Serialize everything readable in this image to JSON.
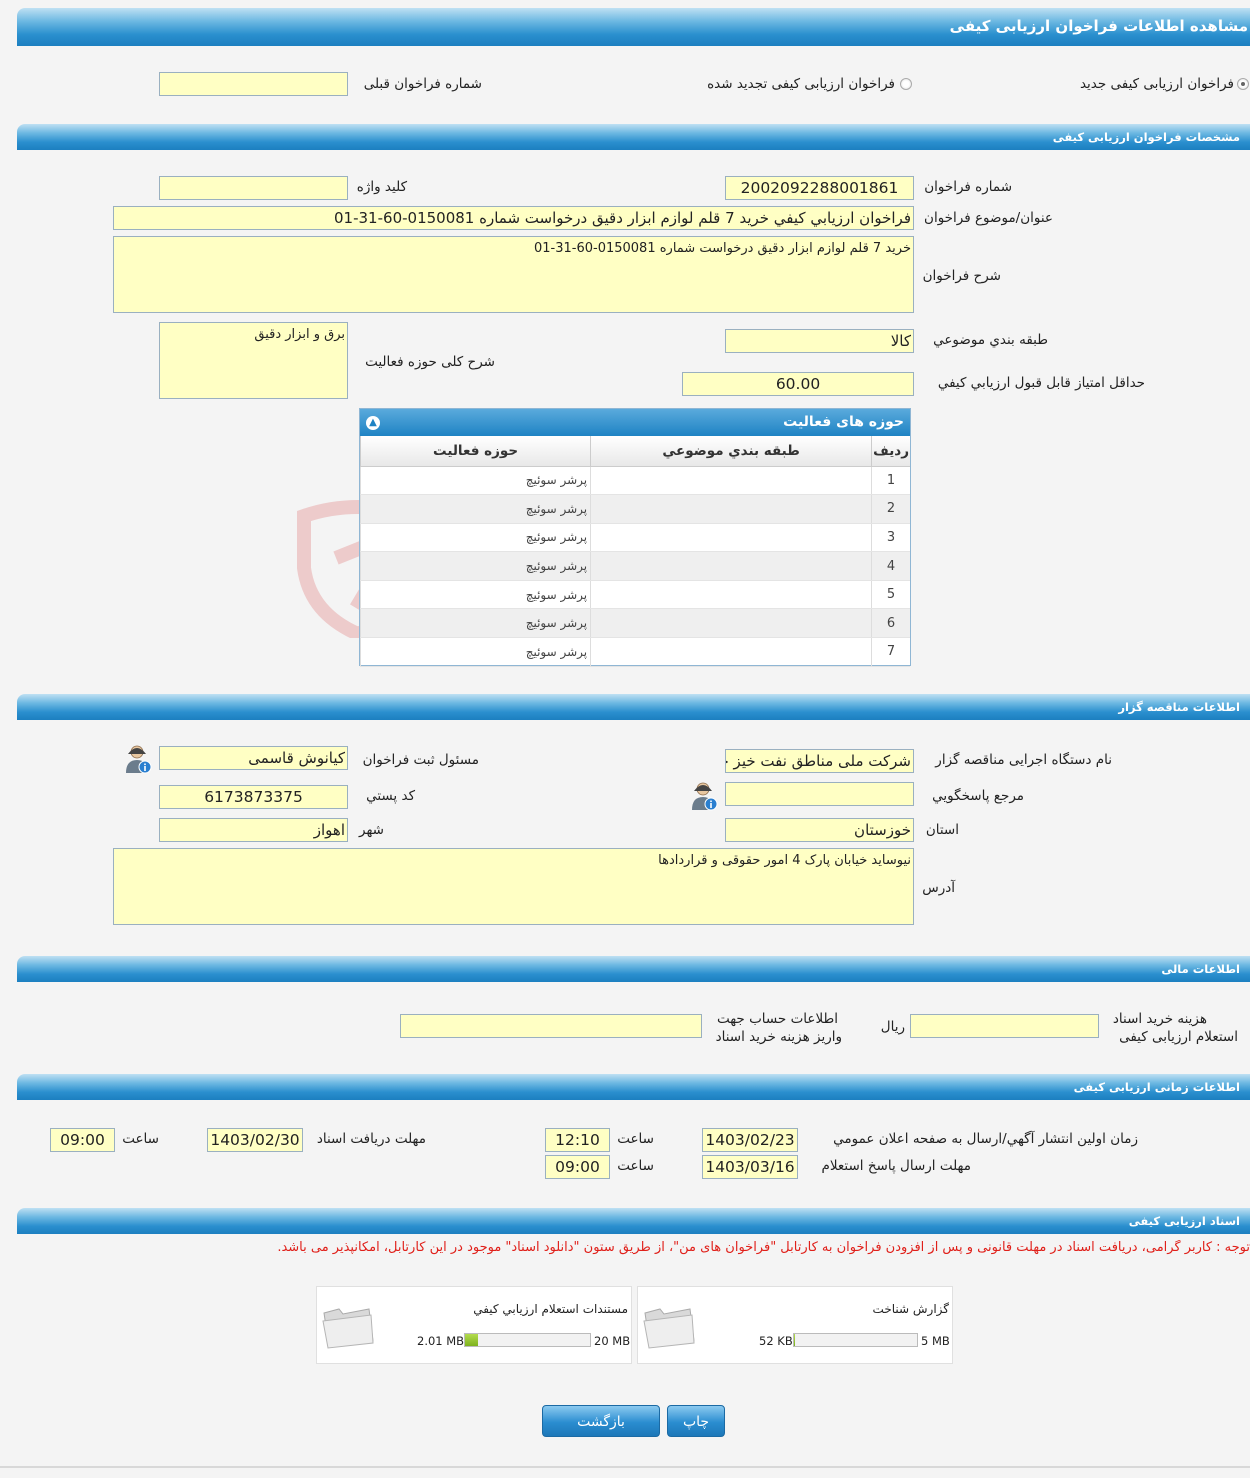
{
  "page_title": "مشاهده اطلاعات فراخوان ارزیابی کیفی",
  "type_options": {
    "new_label": "فراخوان ارزیابی کیفی جدید",
    "renewed_label": "فراخوان ارزیابی کیفی تجدید شده",
    "prev_number_label": "شماره فراخوان قبلی",
    "prev_number_value": "",
    "selected": "new"
  },
  "spec": {
    "section_title": "مشخصات فراخوان ارزیابی کیفی",
    "number_label": "شماره فراخوان",
    "number_value": "2002092288001861",
    "keyword_label": "کلید واژه",
    "keyword_value": "",
    "subject_label": "عنوان/موضوع فراخوان",
    "subject_value": "فراخوان ارزيابي كيفي خريد 7 قلم لوازم ابزار دقيق درخواست شماره 0150081-60-31-01",
    "desc_label": "شرح فراخوان",
    "desc_value": "خرید 7 قلم لوازم ابزار دقیق درخواست شماره 0150081-60-31-01",
    "category_label": "طبقه بندي موضوعي",
    "category_value": "كالا",
    "activity_desc_label": "شرح کلی حوزه فعالیت",
    "activity_desc_value": "برق و ابزار دقیق",
    "min_score_label": "حداقل امتياز قابل قبول ارزيابي كيفي",
    "min_score_value": "60.00"
  },
  "activity_grid": {
    "title": "حوزه های فعالیت",
    "columns": [
      "رديف",
      "طبقه بندي موضوعي",
      "حوزه فعاليت"
    ],
    "rows": [
      {
        "n": "1",
        "cat": "",
        "area": "پرشر سوئیچ"
      },
      {
        "n": "2",
        "cat": "",
        "area": "پرشر سوئیچ"
      },
      {
        "n": "3",
        "cat": "",
        "area": "پرشر سوئیچ"
      },
      {
        "n": "4",
        "cat": "",
        "area": "پرشر سوئیچ"
      },
      {
        "n": "5",
        "cat": "",
        "area": "پرشر سوئیچ"
      },
      {
        "n": "6",
        "cat": "",
        "area": "پرشر سوئیچ"
      },
      {
        "n": "7",
        "cat": "",
        "area": "پرشر سوئیچ"
      }
    ]
  },
  "organizer": {
    "section_title": "اطلاعات مناقصه گزار",
    "org_label": "نام دستگاه اجرایی مناقصه گزار",
    "org_value": "شرکت ملی مناطق نفت خیز جنوب",
    "responsible_label": "مسئول ثبت فراخوان",
    "responsible_value": "کیانوش  قاسمی",
    "reference_label": "مرجع پاسخگويي",
    "reference_value": "",
    "postal_label": "کد پستي",
    "postal_value": "6173873375",
    "province_label": "استان",
    "province_value": "خوزستان",
    "city_label": "شهر",
    "city_value": "اهواز",
    "address_label": "آدرس",
    "address_value": "نیوساید خیابان پارک 4 امور حقوقی و قراردادها"
  },
  "financial": {
    "section_title": "اطلاعات مالی",
    "fee_label_1": "هزینه خرید اسناد",
    "fee_label_2": "استعلام ارزیابی کیفی",
    "fee_value": "",
    "currency": "ریال",
    "account_label_1": "اطلاعات حساب جهت",
    "account_label_2": "واریز هزینه خرید اسناد",
    "account_value": ""
  },
  "timing": {
    "section_title": "اطلاعات زمانی ارزیابی کیفی",
    "publish_label": "زمان اولين انتشار آگهي/ارسال به صفحه اعلان عمومي",
    "publish_date": "1403/02/23",
    "publish_time": "12:10",
    "receive_label": "مهلت دریافت اسناد",
    "receive_date": "1403/02/30",
    "receive_time": "09:00",
    "answer_label": "مهلت ارسال پاسخ استعلام",
    "answer_date": "1403/03/16",
    "answer_time": "09:00",
    "time_label": "ساعت"
  },
  "documents": {
    "section_title": "اسناد ارزیابی کیفی",
    "notice": "توجه : کاربر گرامی، دریافت اسناد در مهلت قانونی و پس از افزودن فراخوان به کارتابل \"فراخوان های من\"، از طریق ستون \"دانلود اسناد\" موجود در این کارتابل، امکانپذیر می باشد.",
    "items": [
      {
        "title": "گزارش شناخت",
        "max": "5 MB",
        "size": "52 KB",
        "fill": 0.01
      },
      {
        "title": "مستندات استعلام ارزيابي كيفي",
        "max": "20 MB",
        "size": "2.01 MB",
        "fill": 0.1
      }
    ]
  },
  "buttons": {
    "print": "چاپ",
    "back": "بازگشت"
  },
  "colors": {
    "header_blue": "#1c7fc0",
    "field_yellow": "#ffffc4",
    "notice_red": "#e0201a",
    "progress_green": "#7eb21e"
  }
}
